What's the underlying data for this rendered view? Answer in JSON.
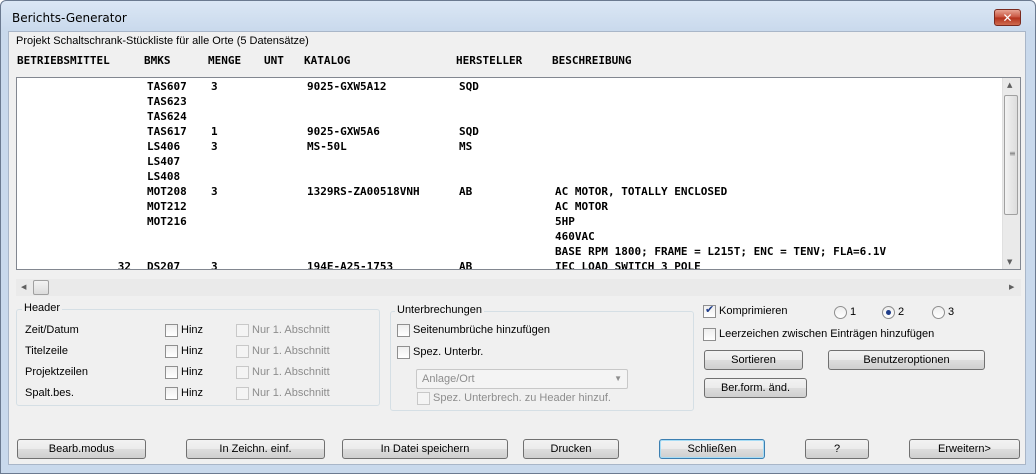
{
  "window": {
    "title": "Berichts-Generator"
  },
  "report": {
    "caption": "Projekt Schaltschrank-Stückliste für alle Orte (5 Datensätze)",
    "columns": [
      "BETRIEBSMITTEL",
      "BMKS",
      "MENGE",
      "UNT",
      "KATALOG",
      "HERSTELLER",
      "BESCHREIBUNG"
    ],
    "rows": [
      [
        "",
        "TAS607",
        "3",
        "",
        "9025-GXW5A12",
        "SQD",
        ""
      ],
      [
        "",
        "TAS623",
        "",
        "",
        "",
        "",
        ""
      ],
      [
        "",
        "TAS624",
        "",
        "",
        "",
        "",
        ""
      ],
      [
        "",
        "TAS617",
        "1",
        "",
        "9025-GXW5A6",
        "SQD",
        ""
      ],
      [
        "",
        "LS406",
        "3",
        "",
        "MS-50L",
        "MS",
        ""
      ],
      [
        "",
        "LS407",
        "",
        "",
        "",
        "",
        ""
      ],
      [
        "",
        "LS408",
        "",
        "",
        "",
        "",
        ""
      ],
      [
        "",
        "MOT208",
        "3",
        "",
        "1329RS-ZA00518VNH",
        "AB",
        "AC MOTOR, TOTALLY ENCLOSED"
      ],
      [
        "",
        "MOT212",
        "",
        "",
        "",
        "",
        "AC MOTOR"
      ],
      [
        "",
        "MOT216",
        "",
        "",
        "",
        "",
        "5HP"
      ],
      [
        "",
        "",
        "",
        "",
        "",
        "",
        "460VAC"
      ],
      [
        "",
        "",
        "",
        "",
        "",
        "",
        "BASE RPM 1800; FRAME = L215T; ENC = TENV; FLA=6.1V"
      ],
      [
        "32",
        "DS207",
        "3",
        "",
        "194E-A25-1753",
        "AB",
        "IEC LOAD SWITCH 3 POLE"
      ]
    ]
  },
  "header_group": {
    "label": "Header",
    "rows": [
      {
        "label": "Zeit/Datum",
        "add": "Hinz",
        "first": "Nur 1. Abschnitt"
      },
      {
        "label": "Titelzeile",
        "add": "Hinz",
        "first": "Nur 1. Abschnitt"
      },
      {
        "label": "Projektzeilen",
        "add": "Hinz",
        "first": "Nur 1. Abschnitt"
      },
      {
        "label": "Spalt.bes.",
        "add": "Hinz",
        "first": "Nur 1. Abschnitt"
      }
    ]
  },
  "breaks_group": {
    "label": "Unterbrechungen",
    "page_breaks": "Seitenumbrüche hinzufügen",
    "special_breaks": "Spez. Unterbr.",
    "select_value": "Anlage/Ort",
    "add_to_header": "Spez. Unterbrech. zu Header hinzuf."
  },
  "options": {
    "compress": "Komprimieren",
    "radio": [
      "1",
      "2",
      "3"
    ],
    "spaces": "Leerzeichen zwischen Einträgen hinzufügen",
    "sort": "Sortieren",
    "user_options": "Benutzeroptionen",
    "format_change": "Ber.form. änd."
  },
  "buttons": {
    "edit_mode": "Bearb.modus",
    "insert_drawing": "In Zeichn. einf.",
    "save_file": "In Datei speichern",
    "print": "Drucken",
    "close": "Schließen",
    "help": "?",
    "expand": "Erweitern>"
  }
}
